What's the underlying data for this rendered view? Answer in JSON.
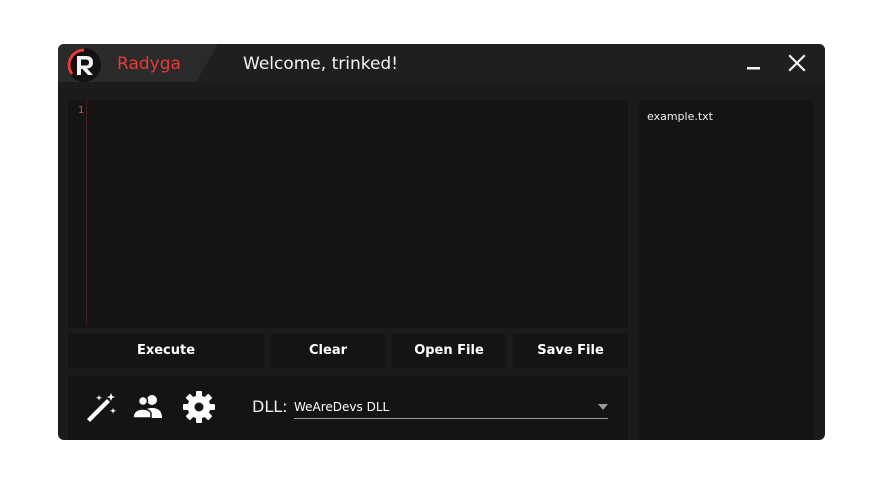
{
  "app": {
    "brand_name": "Radyga",
    "logo_letter": "R",
    "welcome": "Welcome, trinked!"
  },
  "window_controls": {
    "minimize_icon": "minimize-icon",
    "close_icon": "close-icon"
  },
  "editor": {
    "line_numbers": [
      "1"
    ],
    "content": ""
  },
  "files": {
    "items": [
      "example.txt"
    ]
  },
  "actions": {
    "execute": "Execute",
    "clear": "Clear",
    "open_file": "Open File",
    "save_file": "Save File"
  },
  "toolbar": {
    "icons": [
      "magic-wand-icon",
      "users-icon",
      "gear-icon"
    ]
  },
  "dll": {
    "label": "DLL:",
    "selected": "WeAreDevs DLL"
  },
  "colors": {
    "accent": "#e83a3a",
    "window_bg": "#1b1b1b",
    "panel_bg": "#141414",
    "text": "#ffffff"
  }
}
